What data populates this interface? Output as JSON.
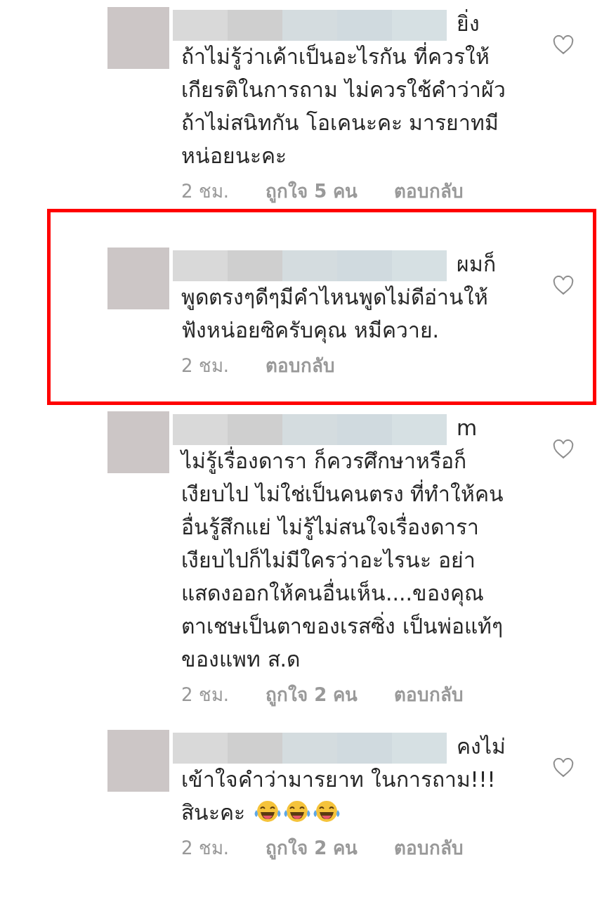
{
  "comments": [
    {
      "username_hidden": true,
      "lines": [
        "ยิ่ง",
        "ถ้าไม่รู้ว่าเค้าเป็นอะไรกัน ที่ควรให้",
        "เกียรติในการถาม ไม่ควรใช้คำว่าผัว",
        "ถ้าไม่สนิทกัน โอเคนะคะ มารยาทมี",
        "หน่อยนะคะ"
      ],
      "time": "2 ชม.",
      "likes": "ถูกใจ 5 คน",
      "reply": "ตอบกลับ",
      "liked": false,
      "highlighted": false
    },
    {
      "username_hidden": true,
      "lines": [
        "ผมก็",
        "พูดตรงๆดีๆมีคำไหนพูดไม่ดีอ่านให้",
        "ฟังหน่อยซิครับคุณ หมีควาย."
      ],
      "time": "2 ชม.",
      "reply": "ตอบกลับ",
      "liked": false,
      "highlighted": true
    },
    {
      "username_hidden": true,
      "lines": [
        "m",
        "ไม่รู้เรื่องดารา ก็ควรศึกษาหรือก็",
        "เงียบไป ไม่ใช่เป็นคนตรง ที่ทำให้คน",
        "อื่นรู้สึกแย่ ไม่รู้ไม่สนใจเรื่องดารา",
        "เงียบไปก็ไม่มีใครว่าอะไรนะ อย่า",
        "แสดงออกให้คนอื่นเห็น....ของคุณ",
        "ตาเชษเป็นตาของเรสซิ่ง เป็นพ่อแท้ๆ",
        "ของแพท ส.ด"
      ],
      "time": "2 ชม.",
      "likes": "ถูกใจ 2 คน",
      "reply": "ตอบกลับ",
      "liked": false,
      "highlighted": false
    },
    {
      "username_hidden": true,
      "lines": [
        "คงไม่",
        "เข้าใจคำว่ามารยาท ในการถาม!!!",
        "สินะคะ"
      ],
      "end_icons": [
        {
          "kind": "tears-of-joy"
        },
        {
          "kind": "tears-of-joy"
        },
        {
          "kind": "tears-of-joy"
        }
      ],
      "time": "2 ชม.",
      "likes": "ถูกใจ 2 คน",
      "reply": "ตอบกลับ",
      "liked": false,
      "highlighted": false
    }
  ]
}
